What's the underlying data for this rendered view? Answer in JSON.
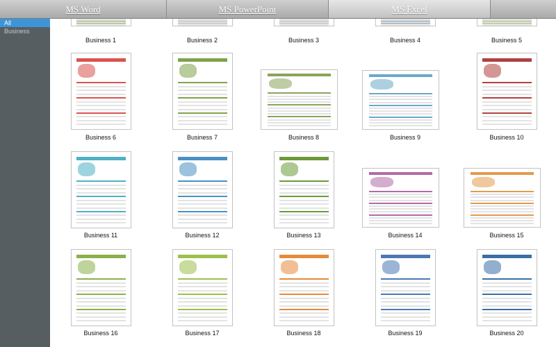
{
  "tabs": [
    {
      "label": "MS Word",
      "active": false
    },
    {
      "label": "MS PowerPoint",
      "active": false
    },
    {
      "label": "MS Excel",
      "active": true
    },
    {
      "label": "",
      "active": false
    }
  ],
  "sidebar": {
    "items": [
      {
        "label": "All",
        "selected": true
      },
      {
        "label": "Business",
        "selected": false
      }
    ]
  },
  "templates": [
    {
      "label": "Business 1",
      "accent": "#9bb86b"
    },
    {
      "label": "Business 2",
      "accent": "#bdbdbd"
    },
    {
      "label": "Business 3",
      "accent": "#bdbdbd"
    },
    {
      "label": "Business 4",
      "accent": "#8aa0b5"
    },
    {
      "label": "Business 5",
      "accent": "#a8c27a"
    },
    {
      "label": "Business 6",
      "accent": "#d9534f"
    },
    {
      "label": "Business 7",
      "accent": "#7ea34a"
    },
    {
      "label": "Business 8",
      "accent": "#8aa35a"
    },
    {
      "label": "Business 9",
      "accent": "#6aa9c9"
    },
    {
      "label": "Business 10",
      "accent": "#b0413e"
    },
    {
      "label": "Business 11",
      "accent": "#4fb0c6"
    },
    {
      "label": "Business 12",
      "accent": "#4a90c2"
    },
    {
      "label": "Business 13",
      "accent": "#6b9a3a"
    },
    {
      "label": "Business 14",
      "accent": "#b06aa8"
    },
    {
      "label": "Business 15",
      "accent": "#e39a4c"
    },
    {
      "label": "Business 16",
      "accent": "#8ab04a"
    },
    {
      "label": "Business 17",
      "accent": "#9cc04a"
    },
    {
      "label": "Business 18",
      "accent": "#e58a3a"
    },
    {
      "label": "Business 19",
      "accent": "#4a78b5"
    },
    {
      "label": "Business 20",
      "accent": "#3a6ea5"
    }
  ]
}
